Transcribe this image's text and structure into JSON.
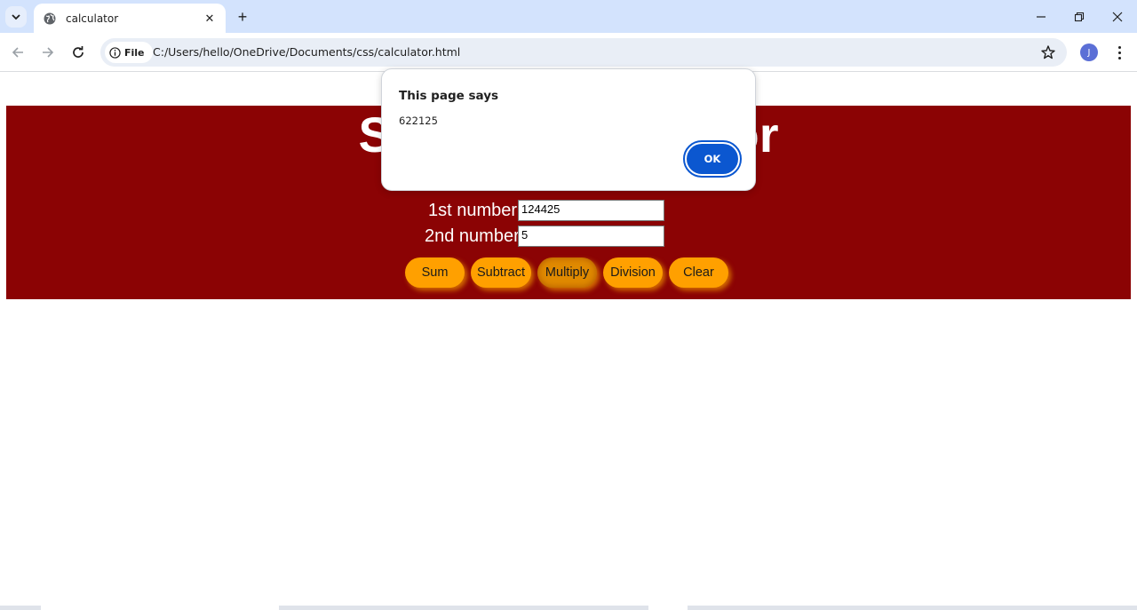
{
  "browser": {
    "tab_title": "calculator",
    "tab_close": "✕",
    "new_tab": "+",
    "address_chip": "File",
    "url": "C:/Users/hello/OneDrive/Documents/css/calculator.html",
    "profile_initial": "J",
    "window_controls": [
      "minimize",
      "restore",
      "close"
    ]
  },
  "page": {
    "heading": "Simple Calculator",
    "fields": [
      {
        "label": "1st number",
        "value": "124425"
      },
      {
        "label": "2nd number",
        "value": "5"
      }
    ],
    "buttons": [
      {
        "label": "Sum"
      },
      {
        "label": "Subtract"
      },
      {
        "label": "Multiply"
      },
      {
        "label": "Division"
      },
      {
        "label": "Clear"
      }
    ],
    "colors": {
      "banner": "#8b0304",
      "button": "#ffa000"
    }
  },
  "dialog": {
    "title": "This page says",
    "message": "622125",
    "ok_label": "OK"
  }
}
